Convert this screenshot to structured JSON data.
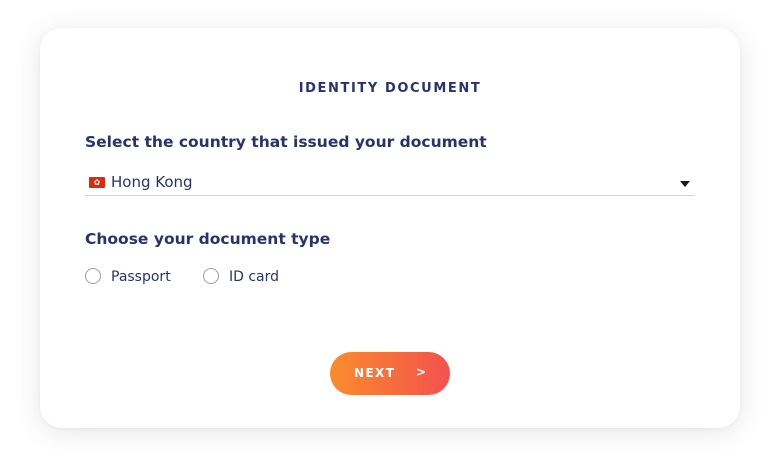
{
  "form": {
    "title": "IDENTITY DOCUMENT",
    "country_label": "Select the country that issued your document",
    "country_select": {
      "value": "Hong Kong",
      "flag_icon": "hong-kong-flag-icon",
      "caret_icon": "caret-down-icon"
    },
    "document_type_label": "Choose your document type",
    "document_types": [
      {
        "label": "Passport",
        "selected": false
      },
      {
        "label": "ID card",
        "selected": false
      }
    ],
    "next_button": {
      "label": "NEXT",
      "icon": ">"
    }
  },
  "colors": {
    "text_primary": "#27336e",
    "button_gradient_start": "#fb8c2c",
    "button_gradient_end": "#f3514e",
    "flag_red": "#de2910"
  }
}
